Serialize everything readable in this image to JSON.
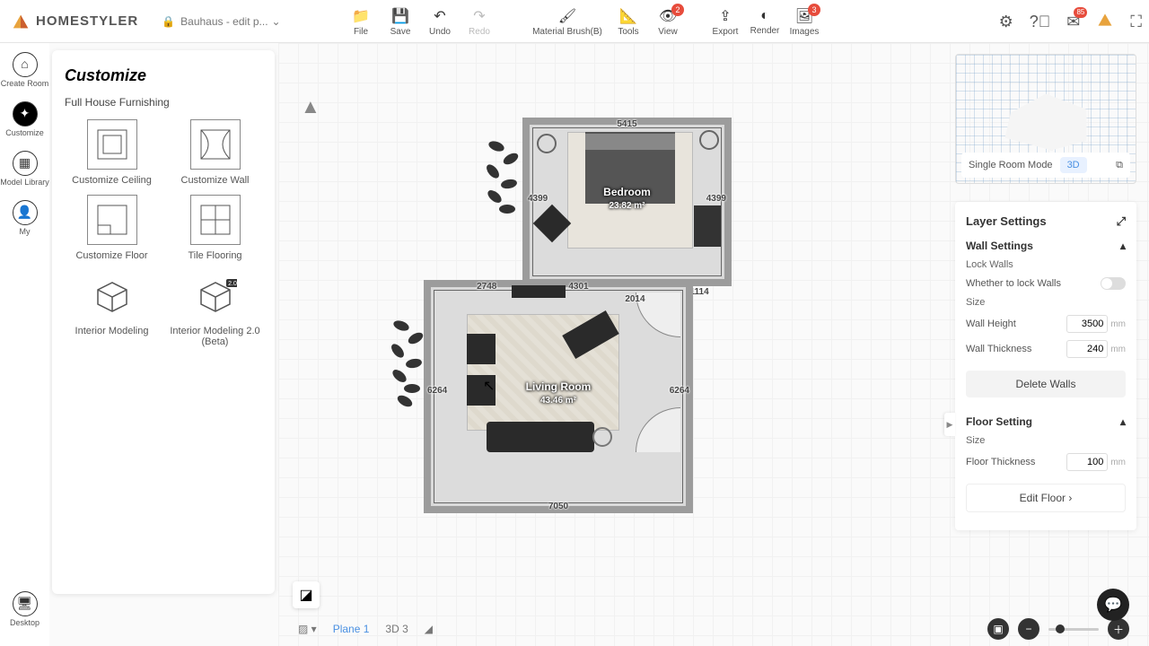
{
  "app": {
    "name": "HOMESTYLER",
    "project": "Bauhaus - edit p..."
  },
  "toolbar": {
    "file": "File",
    "save": "Save",
    "undo": "Undo",
    "redo": "Redo",
    "material_brush": "Material Brush(B)",
    "tools": "Tools",
    "view": "View",
    "export": "Export",
    "render": "Render",
    "images": "Images",
    "view_badge": "2",
    "images_badge": "3",
    "mail_badge": "85"
  },
  "sidebar": {
    "create_room": "Create Room",
    "customize": "Customize",
    "model_library": "Model Library",
    "my": "My",
    "desktop": "Desktop"
  },
  "customize": {
    "title": "Customize",
    "subtitle": "Full House Furnishing",
    "items": [
      {
        "label": "Customize Ceiling"
      },
      {
        "label": "Customize Wall"
      },
      {
        "label": "Customize Floor"
      },
      {
        "label": "Tile Flooring"
      },
      {
        "label": "Interior Modeling"
      },
      {
        "label": "Interior Modeling 2.0 (Beta)"
      }
    ]
  },
  "rooms": {
    "bedroom": {
      "name": "Bedroom",
      "area": "23.82 m²",
      "dims": {
        "top": "5415",
        "left": "4399",
        "right": "4399",
        "bottom_left": "4301",
        "bottom_right": "1114"
      }
    },
    "living": {
      "name": "Living Room",
      "area": "43.46 m²",
      "dims": {
        "top_left": "2748",
        "top_mid": "4301",
        "top_right": "2014",
        "left": "6264",
        "right": "6264",
        "bottom": "7050"
      }
    }
  },
  "preview": {
    "single_room": "Single Room Mode",
    "three_d": "3D"
  },
  "settings": {
    "title": "Layer Settings",
    "wall": {
      "heading": "Wall Settings",
      "lock_walls": "Lock Walls",
      "lock_desc": "Whether to lock Walls",
      "size": "Size",
      "wall_height_label": "Wall Height",
      "wall_height": "3500",
      "wall_thickness_label": "Wall Thickness",
      "wall_thickness": "240",
      "delete": "Delete Walls"
    },
    "floor": {
      "heading": "Floor Setting",
      "size": "Size",
      "floor_thickness_label": "Floor Thickness",
      "floor_thickness": "100",
      "edit": "Edit Floor ›"
    },
    "unit": "mm"
  },
  "bottom": {
    "plane": "Plane 1",
    "three_d": "3D 3"
  }
}
